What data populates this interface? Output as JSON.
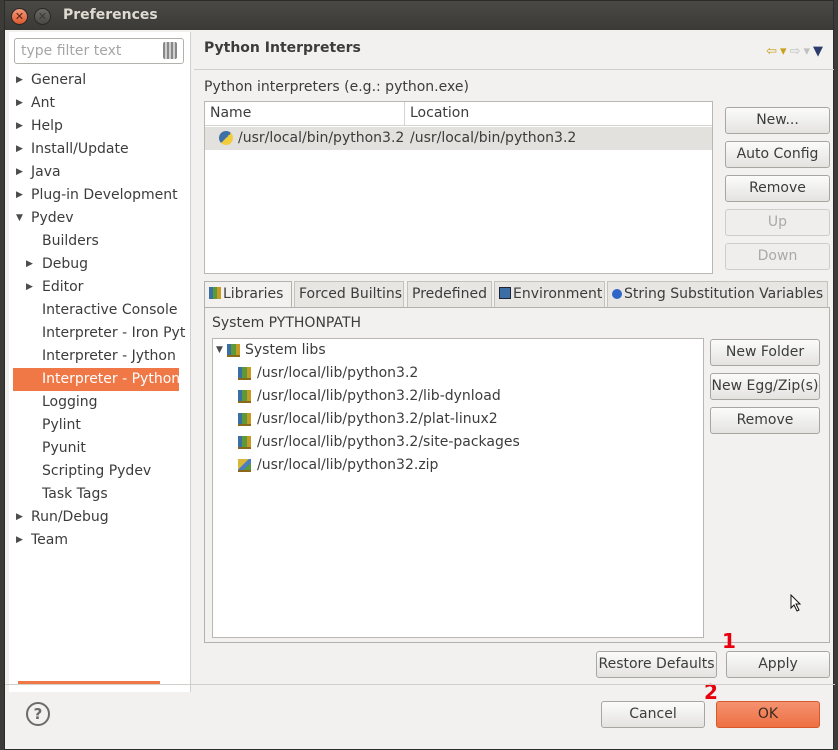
{
  "window": {
    "title": "Preferences"
  },
  "filter": {
    "placeholder": "type filter text"
  },
  "tree": [
    {
      "label": "General",
      "level": 0,
      "arrow": "▶"
    },
    {
      "label": "Ant",
      "level": 0,
      "arrow": "▶"
    },
    {
      "label": "Help",
      "level": 0,
      "arrow": "▶"
    },
    {
      "label": "Install/Update",
      "level": 0,
      "arrow": "▶"
    },
    {
      "label": "Java",
      "level": 0,
      "arrow": "▶"
    },
    {
      "label": "Plug-in Development",
      "level": 0,
      "arrow": "▶"
    },
    {
      "label": "Pydev",
      "level": 0,
      "arrow": "▼"
    },
    {
      "label": "Builders",
      "level": 1,
      "arrow": ""
    },
    {
      "label": "Debug",
      "level": 1,
      "arrow": "▶"
    },
    {
      "label": "Editor",
      "level": 1,
      "arrow": "▶"
    },
    {
      "label": "Interactive Console",
      "level": 1,
      "arrow": ""
    },
    {
      "label": "Interpreter - Iron Pyt",
      "level": 1,
      "arrow": ""
    },
    {
      "label": "Interpreter - Jython",
      "level": 1,
      "arrow": ""
    },
    {
      "label": "Interpreter - Python",
      "level": 1,
      "arrow": "",
      "selected": true
    },
    {
      "label": "Logging",
      "level": 1,
      "arrow": ""
    },
    {
      "label": "Pylint",
      "level": 1,
      "arrow": ""
    },
    {
      "label": "Pyunit",
      "level": 1,
      "arrow": ""
    },
    {
      "label": "Scripting Pydev",
      "level": 1,
      "arrow": ""
    },
    {
      "label": "Task Tags",
      "level": 1,
      "arrow": ""
    },
    {
      "label": "Run/Debug",
      "level": 0,
      "arrow": "▶"
    },
    {
      "label": "Team",
      "level": 0,
      "arrow": "▶"
    }
  ],
  "page": {
    "title": "Python Interpreters",
    "description": "Python interpreters (e.g.: python.exe)"
  },
  "interpreters": {
    "columns": [
      "Name",
      "Location"
    ],
    "rows": [
      {
        "name": "/usr/local/bin/python3.2",
        "location": "/usr/local/bin/python3.2"
      }
    ]
  },
  "interp_buttons": {
    "new": "New...",
    "auto": "Auto Config",
    "remove": "Remove",
    "up": "Up",
    "down": "Down"
  },
  "tabs": [
    "Libraries",
    "Forced Builtins",
    "Predefined",
    "Environment",
    "String Substitution Variables"
  ],
  "libraries": {
    "section_label": "System PYTHONPATH",
    "root": "System libs",
    "items": [
      "/usr/local/lib/python3.2",
      "/usr/local/lib/python3.2/lib-dynload",
      "/usr/local/lib/python3.2/plat-linux2",
      "/usr/local/lib/python3.2/site-packages",
      "/usr/local/lib/python32.zip"
    ]
  },
  "lib_buttons": {
    "new_folder": "New Folder",
    "new_egg": "New Egg/Zip(s)",
    "remove": "Remove"
  },
  "page_buttons": {
    "restore": "Restore Defaults",
    "apply": "Apply"
  },
  "dialog_buttons": {
    "cancel": "Cancel",
    "ok": "OK"
  },
  "annotations": {
    "mark1": "1",
    "mark2": "2"
  },
  "help": {
    "glyph": "?"
  },
  "colors": {
    "accent": "#f07746",
    "titlebar": "#3c3b37"
  }
}
